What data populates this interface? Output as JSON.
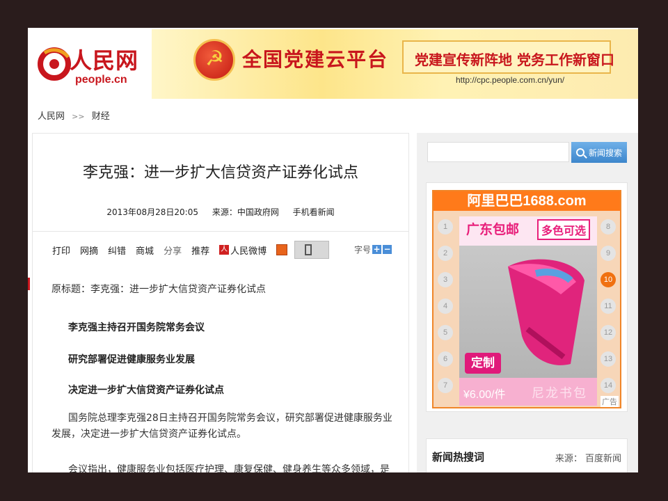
{
  "header": {
    "logo_cn": "人民网",
    "logo_en": "people.cn",
    "banner": {
      "title": "全国党建云平台",
      "slogan": "党建宣传新阵地  党务工作新窗口",
      "url": "http://cpc.people.com.cn/yun/"
    }
  },
  "breadcrumb": {
    "home": "人民网",
    "separator": ">>",
    "section": "财经"
  },
  "article": {
    "title": "李克强：进一步扩大信贷资产证券化试点",
    "date": "2013年08月28日20:05",
    "source": "来源：中国政府网",
    "mobile": "手机看新闻",
    "toolbar": [
      "打印",
      "网摘",
      "纠错",
      "商城",
      "分享",
      "推荐"
    ],
    "weibo": "人民微博",
    "font_size_label": "字号",
    "original_title": "原标题：李克强：进一步扩大信贷资产证券化试点",
    "subheads": [
      "李克强主持召开国务院常务会议",
      "研究部署促进健康服务业发展",
      "决定进一步扩大信贷资产证券化试点"
    ],
    "para1": "国务院总理李克强28日主持召开国务院常务会议，研究部署促进健康服务业发展，决定进一步扩大信贷资产证券化试点。",
    "para2": "会议指出，健康服务业包括医疗护理、康复保健、健身养生等众多领域，是现代服"
  },
  "sidebar": {
    "search_button": "新闻搜索",
    "ad": {
      "header": "阿里巴巴1688.com",
      "tagline1": "广东包邮",
      "tagline2": "多色可选",
      "custom": "定制",
      "price": "¥6.00/件",
      "product": "尼龙书包",
      "label": "广告",
      "numbers": [
        "1",
        "2",
        "3",
        "4",
        "5",
        "6",
        "7",
        "8",
        "9",
        "10",
        "11",
        "12",
        "13",
        "14"
      ],
      "active": "10"
    },
    "hot": {
      "title": "新闻热搜词",
      "source": "来源：  百度新闻"
    }
  },
  "colors": {
    "brand_red": "#c8161d",
    "accent_orange": "#ff7a1a",
    "search_blue": "#3d86cc"
  }
}
